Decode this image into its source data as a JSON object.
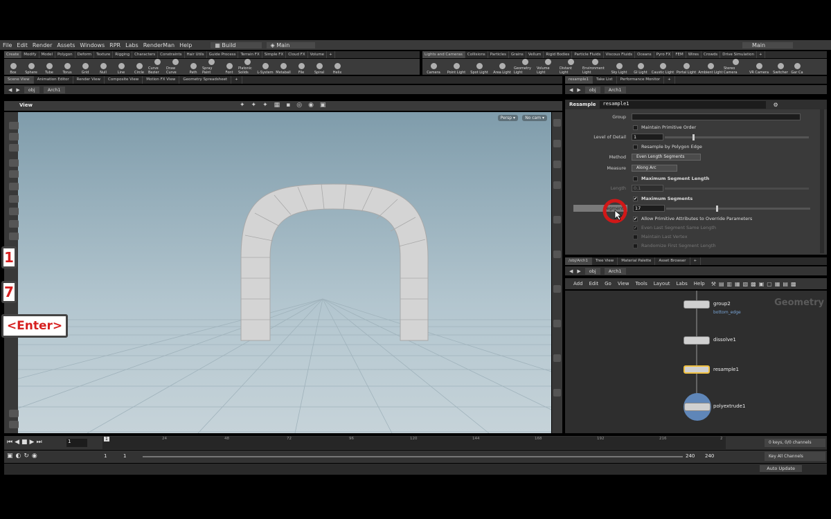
{
  "menubar": {
    "items": [
      "File",
      "Edit",
      "Render",
      "Assets",
      "Windows",
      "RPR",
      "Labs",
      "RenderMan",
      "Help"
    ],
    "desktop": "Build",
    "context": "Main",
    "right_context": "Main"
  },
  "shelf_tabs_left": [
    "Create",
    "Modify",
    "Model",
    "Polygon",
    "Deform",
    "Texture",
    "Rigging",
    "Characters",
    "Constraints",
    "Hair Utils",
    "Guide Process",
    "Terrain FX",
    "Simple FX",
    "Cloud FX",
    "Volume"
  ],
  "shelf_tabs_right": [
    "Lights and Cameras",
    "Collisions",
    "Particles",
    "Grains",
    "Vellum",
    "Rigid Bodies",
    "Particle Fluids",
    "Viscous Fluids",
    "Oceans",
    "Pyro FX",
    "FEM",
    "Wires",
    "Crowds",
    "Drive Simulation"
  ],
  "tools_left": [
    "Box",
    "Sphere",
    "Tube",
    "Torus",
    "Grid",
    "Null",
    "Line",
    "Circle",
    "Curve Bezier",
    "Draw Curve",
    "Path",
    "Spray Paint",
    "Font",
    "Platonic Solids",
    "L-System",
    "Metaball",
    "File",
    "Spiral",
    "Helix"
  ],
  "tools_right": [
    "Camera",
    "Point Light",
    "Spot Light",
    "Area Light",
    "Geometry Light",
    "Volume Light",
    "Distant Light",
    "Environment Light",
    "Sky Light",
    "GI Light",
    "Caustic Light",
    "Portal Light",
    "Ambient Light",
    "Stereo Camera",
    "VR Camera",
    "Switcher",
    "Gar Ca"
  ],
  "left_tabs": [
    "Scene View",
    "Animation Editor",
    "Render View",
    "Composite View",
    "Motion FX View",
    "Geometry Spreadsheet"
  ],
  "right_top_tabs": [
    "resample1",
    "Take List",
    "Performance Monitor"
  ],
  "path": {
    "obj": "obj",
    "node": "Arch1"
  },
  "viewport": {
    "title": "View",
    "persp": "Persp ▾",
    "cam": "No cam ▾"
  },
  "params": {
    "op_type": "Resample",
    "op_name": "resample1",
    "group_label": "Group",
    "group_value": "",
    "maintain_primitive_order": "Maintain Primitive Order",
    "lod_label": "Level of Detail",
    "lod_value": "1",
    "resample_by_polygon_edge": "Resample by Polygon Edge",
    "method_label": "Method",
    "method_value": "Even Length Segments",
    "measure_label": "Measure",
    "measure_value": "Along Arc",
    "max_segment_length": "Maximum Segment Length",
    "length_label": "Length",
    "length_value": "0.1",
    "max_segments": "Maximum Segments",
    "segments_label": "Segments",
    "segments_value": "17",
    "allow_override": "Allow Primitive Attributes to Override Parameters",
    "even_last": "Even Last Segment Same Length",
    "maintain_last": "Maintain Last Vertex",
    "randomize_first": "Randomize First Segment Length"
  },
  "network_tabs": [
    "/obj/Arch1",
    "Tree View",
    "Material Palette",
    "Asset Browser"
  ],
  "network_menu": [
    "Add",
    "Edit",
    "Go",
    "View",
    "Tools",
    "Layout",
    "Labs",
    "Help"
  ],
  "network": {
    "context_label": "Geometry",
    "nodes": [
      {
        "name": "group2",
        "sub": "bottom_edge"
      },
      {
        "name": "dissolve1",
        "sub": ""
      },
      {
        "name": "resample1",
        "sub": ""
      },
      {
        "name": "polyextrude1",
        "sub": ""
      }
    ]
  },
  "timeline": {
    "frame": "1",
    "ticks": [
      "24",
      "48",
      "72",
      "96",
      "120",
      "144",
      "168",
      "192",
      "216",
      "2"
    ],
    "start": "1",
    "start2": "1",
    "end": "240",
    "end2": "240",
    "current_marker": "1",
    "keys": "0 keys, 0/0 channels",
    "key_all": "Key All Channels",
    "auto_update": "Auto Update"
  },
  "overlay_keys": {
    "k1": "1",
    "k2": "7",
    "k3": "<Enter>"
  },
  "accent": {
    "selected_node": "#f0c040",
    "red_circle": "#d11818"
  }
}
